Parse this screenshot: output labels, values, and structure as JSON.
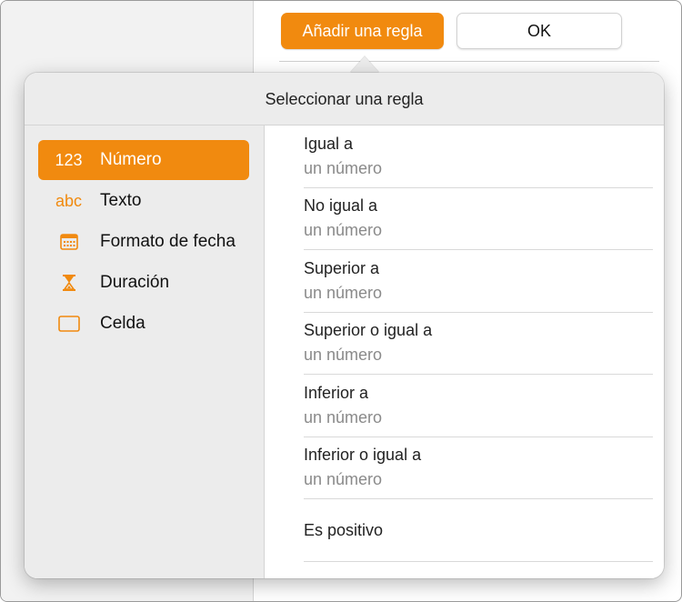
{
  "toolbar": {
    "add_rule_label": "Añadir una regla",
    "ok_label": "OK"
  },
  "colors": {
    "accent": "#f18a0f"
  },
  "popover": {
    "title": "Seleccionar una regla",
    "categories": [
      {
        "icon_text": "123",
        "icon": "number-icon",
        "label": "Número",
        "selected": true
      },
      {
        "icon_text": "abc",
        "icon": "text-icon",
        "label": "Texto",
        "selected": false
      },
      {
        "icon_text": "",
        "icon": "calendar-icon",
        "label": "Formato de fecha",
        "selected": false
      },
      {
        "icon_text": "",
        "icon": "hourglass-icon",
        "label": "Duración",
        "selected": false
      },
      {
        "icon_text": "",
        "icon": "cell-icon",
        "label": "Celda",
        "selected": false
      }
    ],
    "rules": [
      {
        "title": "Igual a",
        "subtitle": "un número"
      },
      {
        "title": "No igual a",
        "subtitle": "un número"
      },
      {
        "title": "Superior a",
        "subtitle": "un número"
      },
      {
        "title": "Superior o igual a",
        "subtitle": "un número"
      },
      {
        "title": "Inferior a",
        "subtitle": "un número"
      },
      {
        "title": "Inferior o igual a",
        "subtitle": "un número"
      },
      {
        "title": "Es positivo",
        "subtitle": ""
      }
    ]
  }
}
